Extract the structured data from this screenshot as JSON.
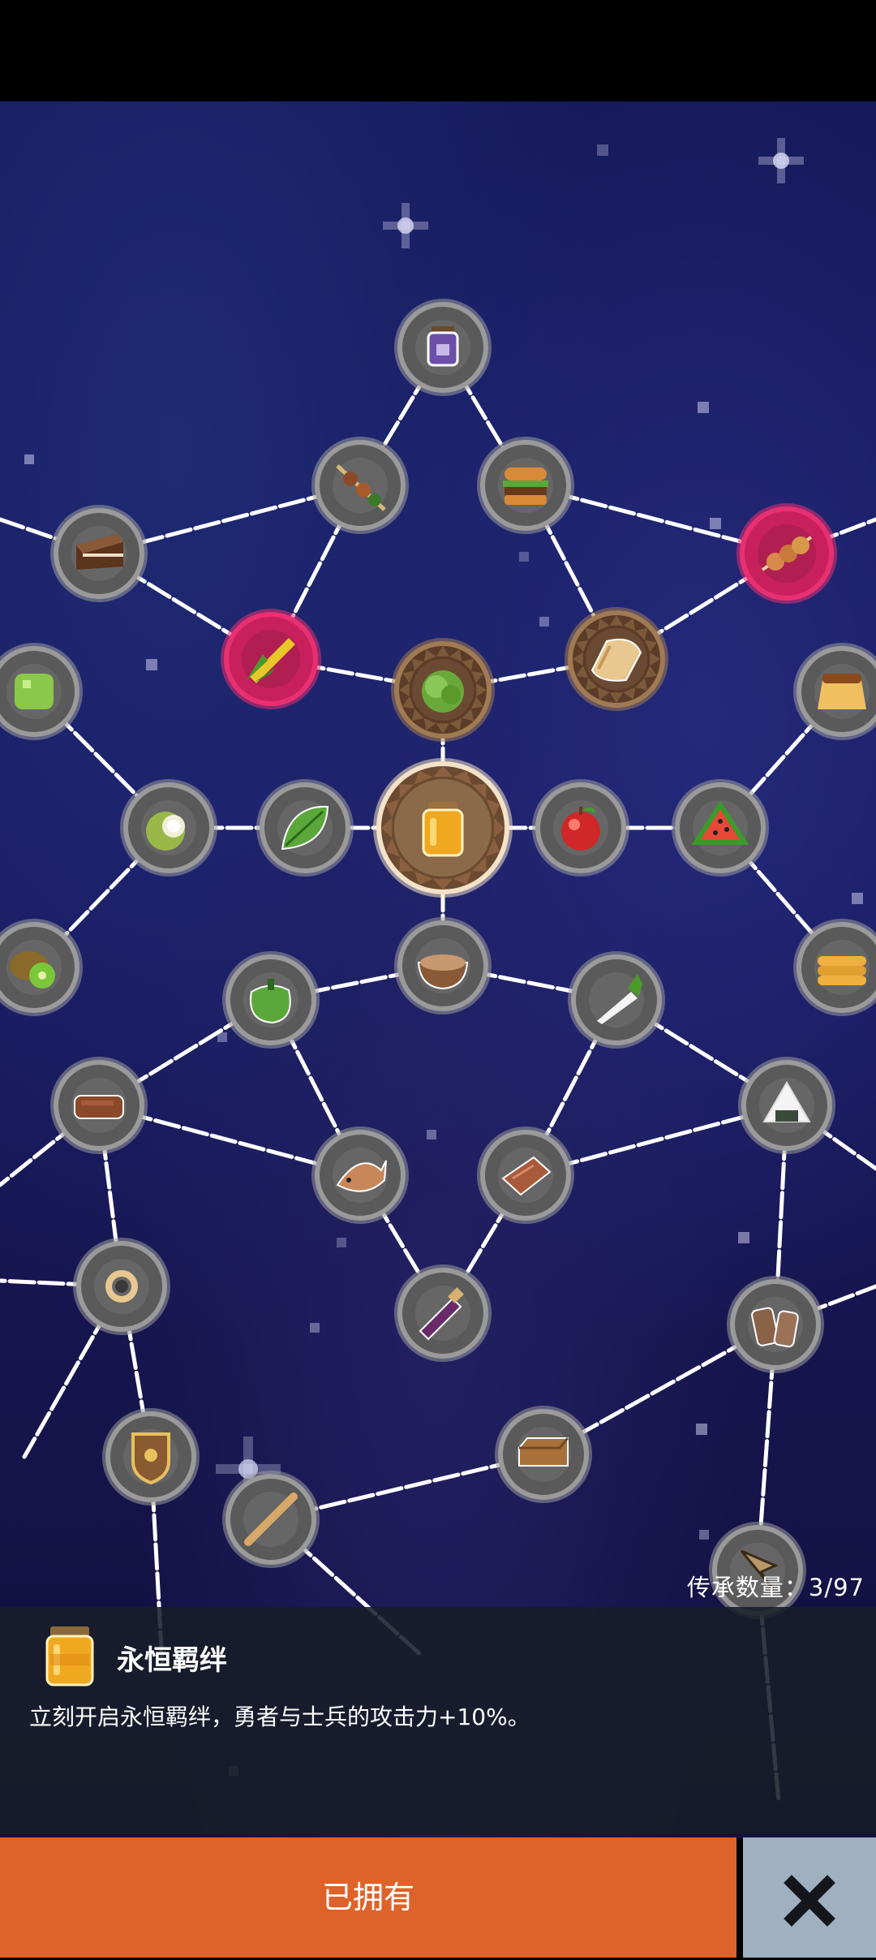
{
  "legacy_count": "传承数量：3/97",
  "selected_item": {
    "name": "永恒羁绊",
    "description": "立刻开启永恒羁绊，勇者与士兵的攻击力+10%。",
    "icon": "honey-jar-icon"
  },
  "owned_button_label": "已拥有",
  "close_icon": "close-x-icon",
  "colors": {
    "owned_button": "#dd632a",
    "close_button": "#9fb0c1",
    "highlight_node": "#c8205c",
    "bronze_node": "#6a4a32",
    "background": "#1a1b66"
  },
  "nodes": [
    {
      "name": "potion-jar",
      "state": "normal"
    },
    {
      "name": "meat-skewer",
      "state": "normal"
    },
    {
      "name": "hamburger",
      "state": "normal"
    },
    {
      "name": "chocolate-cake",
      "state": "normal"
    },
    {
      "name": "dango-skewer",
      "state": "highlight"
    },
    {
      "name": "corn",
      "state": "highlight"
    },
    {
      "name": "lettuce",
      "state": "bronze"
    },
    {
      "name": "bread",
      "state": "bronze"
    },
    {
      "name": "green-jelly",
      "state": "normal"
    },
    {
      "name": "pudding",
      "state": "normal"
    },
    {
      "name": "coconut",
      "state": "normal"
    },
    {
      "name": "leaf",
      "state": "normal"
    },
    {
      "name": "honey-jar",
      "state": "center"
    },
    {
      "name": "apple",
      "state": "normal"
    },
    {
      "name": "watermelon",
      "state": "normal"
    },
    {
      "name": "kiwi",
      "state": "normal"
    },
    {
      "name": "porridge-bowl",
      "state": "normal"
    },
    {
      "name": "pancakes",
      "state": "normal"
    },
    {
      "name": "green-pepper",
      "state": "normal"
    },
    {
      "name": "radish",
      "state": "normal"
    },
    {
      "name": "chocolate-bar",
      "state": "normal"
    },
    {
      "name": "rice-ball",
      "state": "normal"
    },
    {
      "name": "fish",
      "state": "normal"
    },
    {
      "name": "steak",
      "state": "normal"
    },
    {
      "name": "ring",
      "state": "normal"
    },
    {
      "name": "wine-bottle",
      "state": "normal"
    },
    {
      "name": "firewood",
      "state": "normal"
    },
    {
      "name": "shield",
      "state": "normal"
    },
    {
      "name": "brick",
      "state": "normal"
    },
    {
      "name": "wooden-stick",
      "state": "normal"
    },
    {
      "name": "arrow-head",
      "state": "normal"
    }
  ]
}
